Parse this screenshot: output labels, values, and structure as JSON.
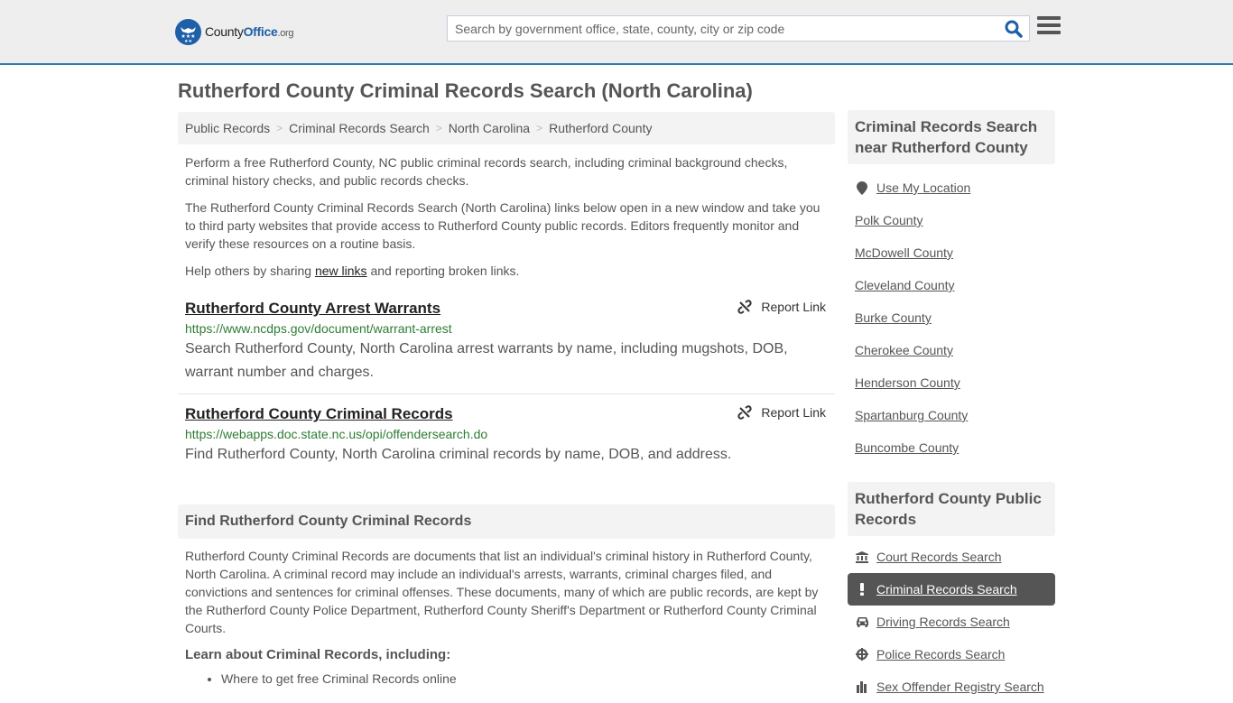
{
  "header": {
    "logo": {
      "name": "County",
      "name_bold": "Office",
      "tld": ".org",
      "brand_color": "#1d5fa8"
    },
    "search": {
      "placeholder": "Search by government office, state, county, city or zip code",
      "value": ""
    },
    "icons": {
      "search": "search-icon",
      "menu": "hamburger-menu-icon"
    }
  },
  "page": {
    "title": "Rutherford County Criminal Records Search (North Carolina)",
    "breadcrumb": [
      "Public Records",
      "Criminal Records Search",
      "North Carolina",
      "Rutherford County"
    ],
    "intro": {
      "p1": "Perform a free Rutherford County, NC public criminal records search, including criminal background checks, criminal history checks, and public records checks.",
      "p2": "The Rutherford County Criminal Records Search (North Carolina) links below open in a new window and take you to third party websites that provide access to Rutherford County public records. Editors frequently monitor and verify these resources on a routine basis.",
      "p3_before": "Help others by sharing ",
      "p3_link": "new links",
      "p3_after": " and reporting broken links."
    },
    "results": [
      {
        "title": "Rutherford County Arrest Warrants",
        "url": "https://www.ncdps.gov/document/warrant-arrest",
        "description": "Search Rutherford County, North Carolina arrest warrants by name, including mugshots, DOB, warrant number and charges.",
        "report_label": "Report Link"
      },
      {
        "title": "Rutherford County Criminal Records",
        "url": "https://webapps.doc.state.nc.us/opi/offendersearch.do",
        "description": "Find Rutherford County, North Carolina criminal records by name, DOB, and address.",
        "report_label": "Report Link"
      }
    ],
    "find_section": {
      "heading": "Find Rutherford County Criminal Records",
      "body": "Rutherford County Criminal Records are documents that list an individual's criminal history in Rutherford County, North Carolina. A criminal record may include an individual's arrests, warrants, criminal charges filed, and convictions and sentences for criminal offenses. These documents, many of which are public records, are kept by the Rutherford County Police Department, Rutherford County Sheriff's Department or Rutherford County Criminal Courts.",
      "learn_heading": "Learn about Criminal Records, including:",
      "learn_items": [
        "Where to get free Criminal Records online"
      ]
    }
  },
  "sidebar": {
    "near": {
      "heading": "Criminal Records Search near Rutherford County",
      "use_location": "Use My Location",
      "counties": [
        "Polk County",
        "McDowell County",
        "Cleveland County",
        "Burke County",
        "Cherokee County",
        "Henderson County",
        "Spartanburg County",
        "Buncombe County"
      ]
    },
    "public_records": {
      "heading": "Rutherford County Public Records",
      "items": [
        {
          "label": "Court Records Search",
          "icon": "courthouse-icon",
          "active": false
        },
        {
          "label": "Criminal Records Search",
          "icon": "exclamation-icon",
          "active": true
        },
        {
          "label": "Driving Records Search",
          "icon": "car-icon",
          "active": false
        },
        {
          "label": "Police Records Search",
          "icon": "crosshair-icon",
          "active": false
        },
        {
          "label": "Sex Offender Registry Search",
          "icon": "building-icon",
          "active": false
        }
      ]
    }
  }
}
